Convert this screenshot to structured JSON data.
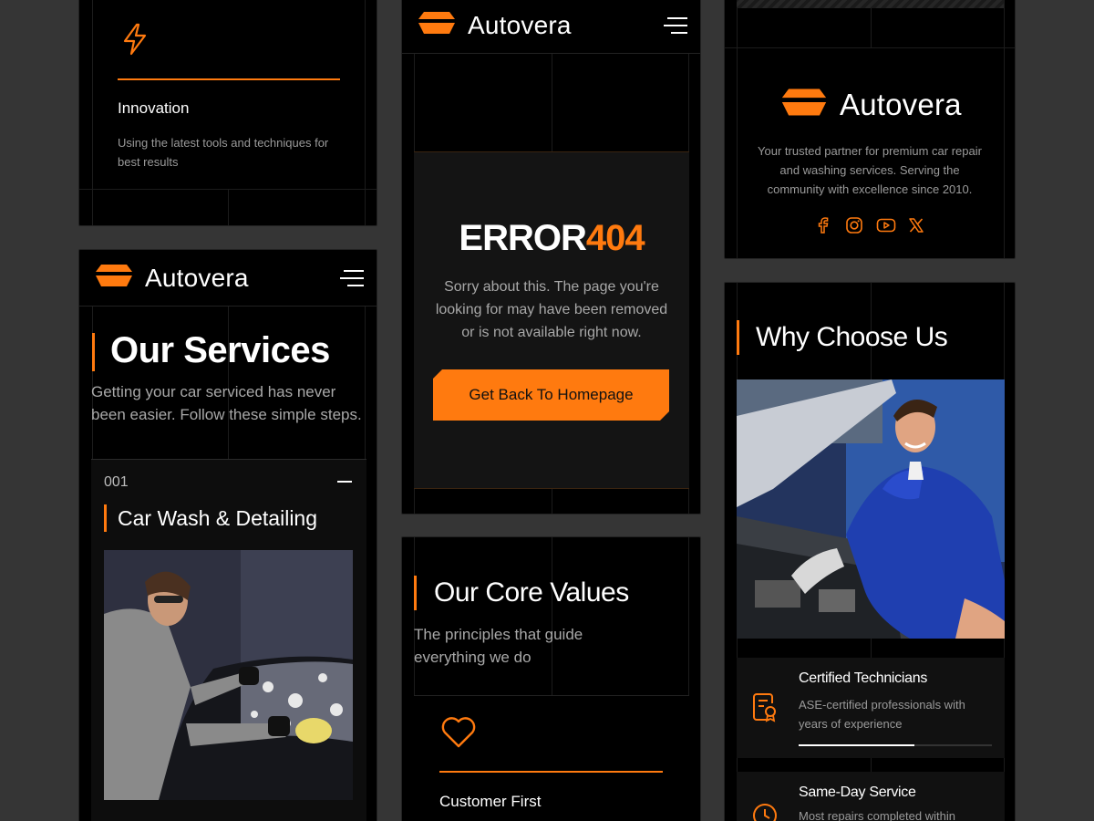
{
  "brand": {
    "name": "Autovera",
    "accent_color": "#ff7a0f"
  },
  "innovation_card": {
    "icon": "lightning-icon",
    "title": "Innovation",
    "text_line1": "Using the latest tools and techniques for",
    "text_line2": "best results"
  },
  "services": {
    "title": "Our Services",
    "subtitle_line1": "Getting your car serviced has never",
    "subtitle_line2": "been easier. Follow these simple steps.",
    "item": {
      "number": "001",
      "title": "Car Wash & Detailing",
      "toggle_icon": "minus-icon"
    }
  },
  "error_page": {
    "error_word": "ERROR",
    "error_code": "404",
    "message_line1": "Sorry about this. The page you're",
    "message_line2": "looking for may have been removed",
    "message_line3": "or is not available right now.",
    "button_label": "Get Back To Homepage"
  },
  "core_values": {
    "title": "Our Core Values",
    "subtitle_line1": "The principles that guide",
    "subtitle_line2": "everything we do",
    "value": {
      "icon": "heart-icon",
      "title": "Customer First"
    }
  },
  "footer": {
    "description_line1": "Your trusted partner for premium car repair",
    "description_line2": "and washing services. Serving the",
    "description_line3": "community with excellence since 2010.",
    "social_icons": [
      "facebook-icon",
      "instagram-icon",
      "youtube-icon",
      "x-icon"
    ]
  },
  "why_choose": {
    "title": "Why Choose Us",
    "features": [
      {
        "icon": "certificate-icon",
        "title": "Certified Technicians",
        "text_line1": "ASE-certified professionals with",
        "text_line2": "years of experience",
        "progress": 0.6
      },
      {
        "icon": "clock-icon",
        "title": "Same-Day Service",
        "text_line1": "Most repairs completed within"
      }
    ]
  }
}
